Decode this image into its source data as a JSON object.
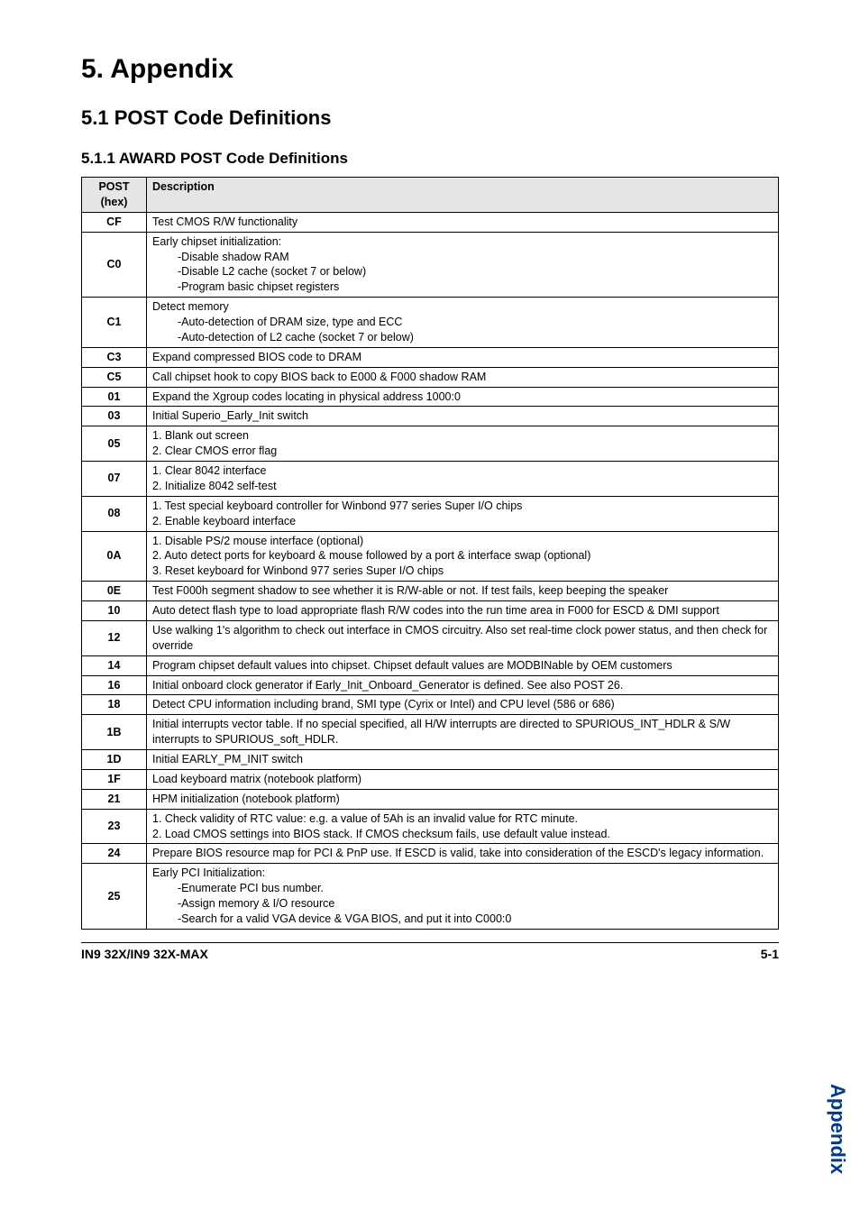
{
  "headings": {
    "h1": "5. Appendix",
    "h2": "5.1 POST Code Definitions",
    "h3": "5.1.1 AWARD POST Code Definitions"
  },
  "table": {
    "header": {
      "col1_line1": "POST",
      "col1_line2": "(hex)",
      "col2": "Description"
    },
    "rows": [
      {
        "code": "CF",
        "desc": "Test CMOS R/W functionality"
      },
      {
        "code": "C0",
        "desc": "Early chipset initialization:",
        "sub": [
          "-Disable shadow RAM",
          "-Disable L2 cache (socket 7 or below)",
          "-Program basic chipset registers"
        ]
      },
      {
        "code": "C1",
        "desc": "Detect memory",
        "sub": [
          "-Auto-detection of DRAM size, type and ECC",
          "-Auto-detection of L2 cache (socket 7 or below)"
        ]
      },
      {
        "code": "C3",
        "desc": "Expand compressed BIOS code to DRAM"
      },
      {
        "code": "C5",
        "desc": "Call chipset hook to copy BIOS back to E000 & F000 shadow RAM"
      },
      {
        "code": "01",
        "desc": "Expand the Xgroup codes locating in physical address 1000:0"
      },
      {
        "code": "03",
        "desc": "Initial Superio_Early_Init switch"
      },
      {
        "code": "05",
        "lines": [
          "1. Blank out screen",
          "2. Clear CMOS error flag"
        ]
      },
      {
        "code": "07",
        "lines": [
          "1. Clear 8042 interface",
          "2. Initialize 8042 self-test"
        ]
      },
      {
        "code": "08",
        "lines": [
          "1. Test special keyboard controller for Winbond 977 series Super I/O chips",
          "2. Enable keyboard interface"
        ]
      },
      {
        "code": "0A",
        "lines": [
          "1. Disable PS/2 mouse interface (optional)",
          "2. Auto detect ports for keyboard & mouse followed by a port & interface swap (optional)",
          "3. Reset keyboard for Winbond 977 series Super I/O chips"
        ]
      },
      {
        "code": "0E",
        "desc": "Test F000h segment shadow to see whether it is R/W-able or not. If test fails, keep beeping the speaker"
      },
      {
        "code": "10",
        "desc": "Auto detect flash type to load appropriate flash R/W codes into the run time area in F000 for ESCD & DMI support"
      },
      {
        "code": "12",
        "desc": "Use walking 1's algorithm to check out interface in CMOS circuitry. Also set real-time clock power status, and then check for override"
      },
      {
        "code": "14",
        "desc": "Program chipset default values into chipset.   Chipset default values are MODBINable by OEM customers"
      },
      {
        "code": "16",
        "desc": "Initial onboard clock generator if Early_Init_Onboard_Generator is defined. See also POST 26."
      },
      {
        "code": "18",
        "desc": "Detect CPU information including brand, SMI type (Cyrix or Intel) and CPU level (586 or 686)"
      },
      {
        "code": "1B",
        "desc": "Initial interrupts vector table. If no special specified, all H/W interrupts are directed to SPURIOUS_INT_HDLR & S/W interrupts to SPURIOUS_soft_HDLR."
      },
      {
        "code": "1D",
        "desc": "Initial EARLY_PM_INIT switch"
      },
      {
        "code": "1F",
        "desc": "Load keyboard matrix (notebook platform)"
      },
      {
        "code": "21",
        "desc": "HPM initialization (notebook platform)"
      },
      {
        "code": "23",
        "lines": [
          "1. Check validity of RTC value: e.g. a value of 5Ah is an invalid value for RTC minute.",
          "2. Load CMOS settings into BIOS stack. If CMOS checksum fails, use default value instead."
        ]
      },
      {
        "code": "24",
        "desc": "Prepare BIOS resource map for PCI & PnP use. If ESCD is valid, take into consideration of the ESCD's legacy information."
      },
      {
        "code": "25",
        "desc": "Early PCI Initialization:",
        "sub": [
          "-Enumerate PCI bus number.",
          "-Assign memory & I/O resource",
          "-Search for a valid VGA device & VGA BIOS, and put it into C000:0"
        ]
      }
    ]
  },
  "side_tab": "Appendix",
  "footer": {
    "left": "IN9 32X/IN9 32X-MAX",
    "right": "5-1"
  }
}
